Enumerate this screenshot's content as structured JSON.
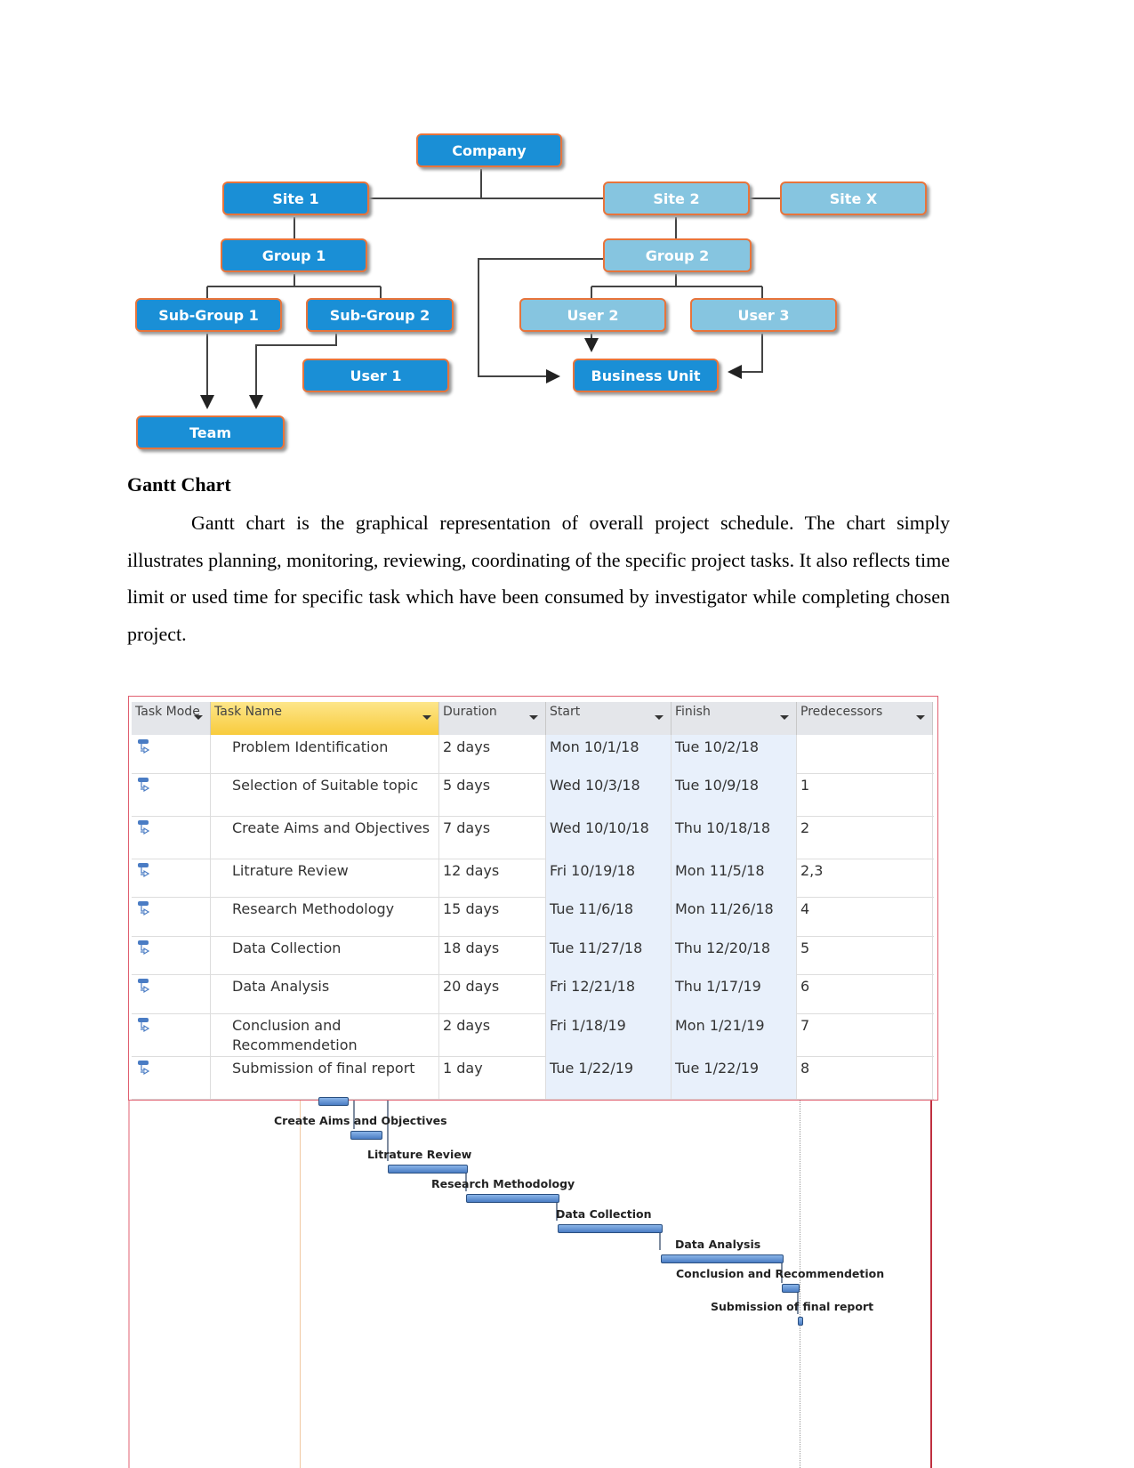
{
  "org_chart": {
    "nodes": [
      "Company",
      "Site 1",
      "Site 2",
      "Site X",
      "Group 1",
      "Group 2",
      "Sub-Group 1",
      "Sub-Group 2",
      "User 2",
      "User 3",
      "User 1",
      "Business Unit",
      "Team"
    ],
    "colors": {
      "dark": "#1a8fd6",
      "light": "#86c5e0",
      "border": "#e8743b"
    }
  },
  "section": {
    "heading": "Gantt Chart",
    "paragraph": "Gantt chart is the graphical representation of overall project schedule. The chart simply illustrates planning, monitoring, reviewing, coordinating of the specific project tasks. It also reflects time limit or used time for specific task which have been consumed by investigator while completing chosen project."
  },
  "gantt_table": {
    "headers": [
      "Task Mode",
      "Task Name",
      "Duration",
      "Start",
      "Finish",
      "Predecessors"
    ],
    "rows": [
      {
        "name": "Problem Identification",
        "duration": "2 days",
        "start": "Mon 10/1/18",
        "finish": "Tue 10/2/18",
        "pred": ""
      },
      {
        "name": "Selection of Suitable topic",
        "duration": "5 days",
        "start": "Wed 10/3/18",
        "finish": "Tue 10/9/18",
        "pred": "1"
      },
      {
        "name": "Create Aims and Objectives",
        "duration": "7 days",
        "start": "Wed 10/10/18",
        "finish": "Thu 10/18/18",
        "pred": "2"
      },
      {
        "name": "Litrature Review",
        "duration": "12 days",
        "start": "Fri 10/19/18",
        "finish": "Mon 11/5/18",
        "pred": "2,3"
      },
      {
        "name": "Research Methodology",
        "duration": "15 days",
        "start": "Tue 11/6/18",
        "finish": "Mon 11/26/18",
        "pred": "4"
      },
      {
        "name": "Data Collection",
        "duration": "18 days",
        "start": "Tue 11/27/18",
        "finish": "Thu 12/20/18",
        "pred": "5"
      },
      {
        "name": "Data Analysis",
        "duration": "20 days",
        "start": "Fri 12/21/18",
        "finish": "Thu 1/17/19",
        "pred": "6"
      },
      {
        "name": "Conclusion and Recommendetion",
        "duration": "2 days",
        "start": "Fri 1/18/19",
        "finish": "Mon 1/21/19",
        "pred": "7"
      },
      {
        "name": "Submission of final report",
        "duration": "1 day",
        "start": "Tue 1/22/19",
        "finish": "Tue 1/22/19",
        "pred": "8"
      }
    ]
  },
  "gantt_bars": {
    "labels": [
      "Create Aims and Objectives",
      "Litrature Review",
      "Research Methodology",
      "Data Collection",
      "Data Analysis",
      "Conclusion and Recommendetion",
      "Submission of final report"
    ],
    "bar_color": "#5a8ad0"
  }
}
